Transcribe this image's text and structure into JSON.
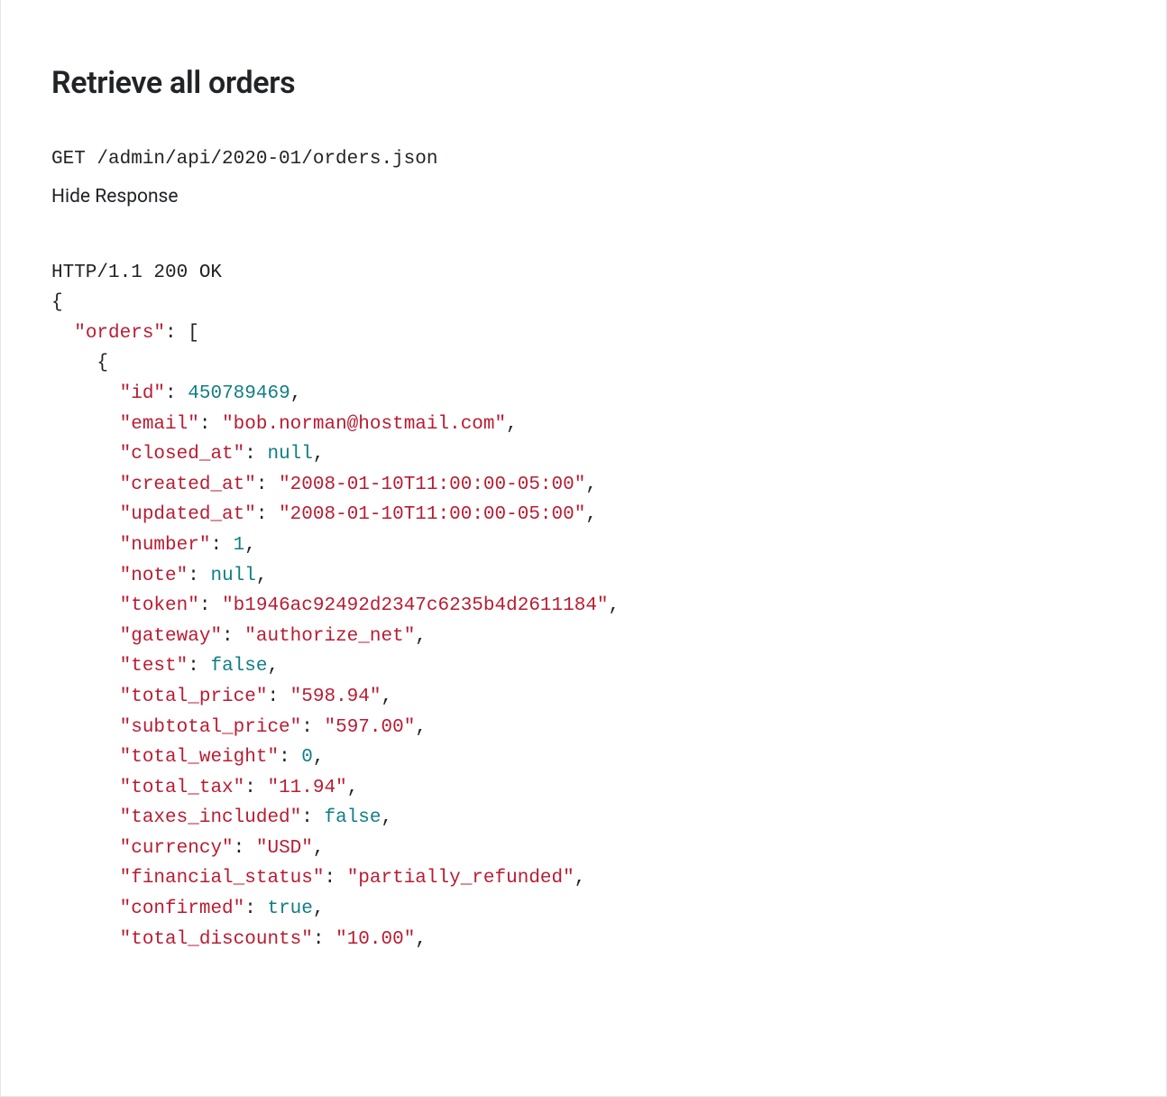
{
  "title": "Retrieve all orders",
  "request_line": "GET /admin/api/2020-01/orders.json",
  "toggle_label": "Hide Response",
  "status_line": "HTTP/1.1 200 OK",
  "json_root_key": "orders",
  "order": {
    "id": 450789469,
    "email": "bob.norman@hostmail.com",
    "closed_at": null,
    "created_at": "2008-01-10T11:00:00-05:00",
    "updated_at": "2008-01-10T11:00:00-05:00",
    "number": 1,
    "note": null,
    "token": "b1946ac92492d2347c6235b4d2611184",
    "gateway": "authorize_net",
    "test": false,
    "total_price": "598.94",
    "subtotal_price": "597.00",
    "total_weight": 0,
    "total_tax": "11.94",
    "taxes_included": false,
    "currency": "USD",
    "financial_status": "partially_refunded",
    "confirmed": true,
    "total_discounts": "10.00"
  },
  "field_order": [
    "id",
    "email",
    "closed_at",
    "created_at",
    "updated_at",
    "number",
    "note",
    "token",
    "gateway",
    "test",
    "total_price",
    "subtotal_price",
    "total_weight",
    "total_tax",
    "taxes_included",
    "currency",
    "financial_status",
    "confirmed",
    "total_discounts"
  ]
}
